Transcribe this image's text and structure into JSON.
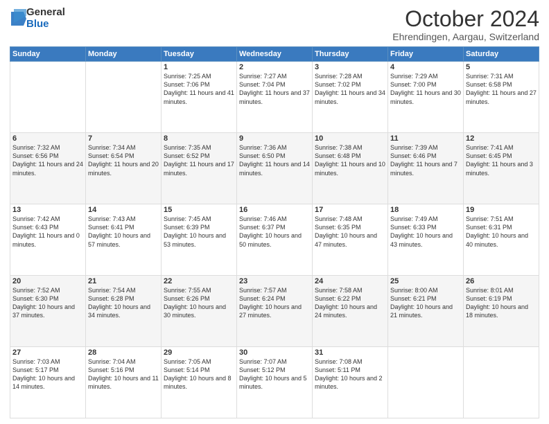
{
  "logo": {
    "general": "General",
    "blue": "Blue"
  },
  "header": {
    "month": "October 2024",
    "location": "Ehrendingen, Aargau, Switzerland"
  },
  "days_of_week": [
    "Sunday",
    "Monday",
    "Tuesday",
    "Wednesday",
    "Thursday",
    "Friday",
    "Saturday"
  ],
  "weeks": [
    [
      {
        "day": "",
        "info": ""
      },
      {
        "day": "",
        "info": ""
      },
      {
        "day": "1",
        "info": "Sunrise: 7:25 AM\nSunset: 7:06 PM\nDaylight: 11 hours and 41 minutes."
      },
      {
        "day": "2",
        "info": "Sunrise: 7:27 AM\nSunset: 7:04 PM\nDaylight: 11 hours and 37 minutes."
      },
      {
        "day": "3",
        "info": "Sunrise: 7:28 AM\nSunset: 7:02 PM\nDaylight: 11 hours and 34 minutes."
      },
      {
        "day": "4",
        "info": "Sunrise: 7:29 AM\nSunset: 7:00 PM\nDaylight: 11 hours and 30 minutes."
      },
      {
        "day": "5",
        "info": "Sunrise: 7:31 AM\nSunset: 6:58 PM\nDaylight: 11 hours and 27 minutes."
      }
    ],
    [
      {
        "day": "6",
        "info": "Sunrise: 7:32 AM\nSunset: 6:56 PM\nDaylight: 11 hours and 24 minutes."
      },
      {
        "day": "7",
        "info": "Sunrise: 7:34 AM\nSunset: 6:54 PM\nDaylight: 11 hours and 20 minutes."
      },
      {
        "day": "8",
        "info": "Sunrise: 7:35 AM\nSunset: 6:52 PM\nDaylight: 11 hours and 17 minutes."
      },
      {
        "day": "9",
        "info": "Sunrise: 7:36 AM\nSunset: 6:50 PM\nDaylight: 11 hours and 14 minutes."
      },
      {
        "day": "10",
        "info": "Sunrise: 7:38 AM\nSunset: 6:48 PM\nDaylight: 11 hours and 10 minutes."
      },
      {
        "day": "11",
        "info": "Sunrise: 7:39 AM\nSunset: 6:46 PM\nDaylight: 11 hours and 7 minutes."
      },
      {
        "day": "12",
        "info": "Sunrise: 7:41 AM\nSunset: 6:45 PM\nDaylight: 11 hours and 3 minutes."
      }
    ],
    [
      {
        "day": "13",
        "info": "Sunrise: 7:42 AM\nSunset: 6:43 PM\nDaylight: 11 hours and 0 minutes."
      },
      {
        "day": "14",
        "info": "Sunrise: 7:43 AM\nSunset: 6:41 PM\nDaylight: 10 hours and 57 minutes."
      },
      {
        "day": "15",
        "info": "Sunrise: 7:45 AM\nSunset: 6:39 PM\nDaylight: 10 hours and 53 minutes."
      },
      {
        "day": "16",
        "info": "Sunrise: 7:46 AM\nSunset: 6:37 PM\nDaylight: 10 hours and 50 minutes."
      },
      {
        "day": "17",
        "info": "Sunrise: 7:48 AM\nSunset: 6:35 PM\nDaylight: 10 hours and 47 minutes."
      },
      {
        "day": "18",
        "info": "Sunrise: 7:49 AM\nSunset: 6:33 PM\nDaylight: 10 hours and 43 minutes."
      },
      {
        "day": "19",
        "info": "Sunrise: 7:51 AM\nSunset: 6:31 PM\nDaylight: 10 hours and 40 minutes."
      }
    ],
    [
      {
        "day": "20",
        "info": "Sunrise: 7:52 AM\nSunset: 6:30 PM\nDaylight: 10 hours and 37 minutes."
      },
      {
        "day": "21",
        "info": "Sunrise: 7:54 AM\nSunset: 6:28 PM\nDaylight: 10 hours and 34 minutes."
      },
      {
        "day": "22",
        "info": "Sunrise: 7:55 AM\nSunset: 6:26 PM\nDaylight: 10 hours and 30 minutes."
      },
      {
        "day": "23",
        "info": "Sunrise: 7:57 AM\nSunset: 6:24 PM\nDaylight: 10 hours and 27 minutes."
      },
      {
        "day": "24",
        "info": "Sunrise: 7:58 AM\nSunset: 6:22 PM\nDaylight: 10 hours and 24 minutes."
      },
      {
        "day": "25",
        "info": "Sunrise: 8:00 AM\nSunset: 6:21 PM\nDaylight: 10 hours and 21 minutes."
      },
      {
        "day": "26",
        "info": "Sunrise: 8:01 AM\nSunset: 6:19 PM\nDaylight: 10 hours and 18 minutes."
      }
    ],
    [
      {
        "day": "27",
        "info": "Sunrise: 7:03 AM\nSunset: 5:17 PM\nDaylight: 10 hours and 14 minutes."
      },
      {
        "day": "28",
        "info": "Sunrise: 7:04 AM\nSunset: 5:16 PM\nDaylight: 10 hours and 11 minutes."
      },
      {
        "day": "29",
        "info": "Sunrise: 7:05 AM\nSunset: 5:14 PM\nDaylight: 10 hours and 8 minutes."
      },
      {
        "day": "30",
        "info": "Sunrise: 7:07 AM\nSunset: 5:12 PM\nDaylight: 10 hours and 5 minutes."
      },
      {
        "day": "31",
        "info": "Sunrise: 7:08 AM\nSunset: 5:11 PM\nDaylight: 10 hours and 2 minutes."
      },
      {
        "day": "",
        "info": ""
      },
      {
        "day": "",
        "info": ""
      }
    ]
  ]
}
